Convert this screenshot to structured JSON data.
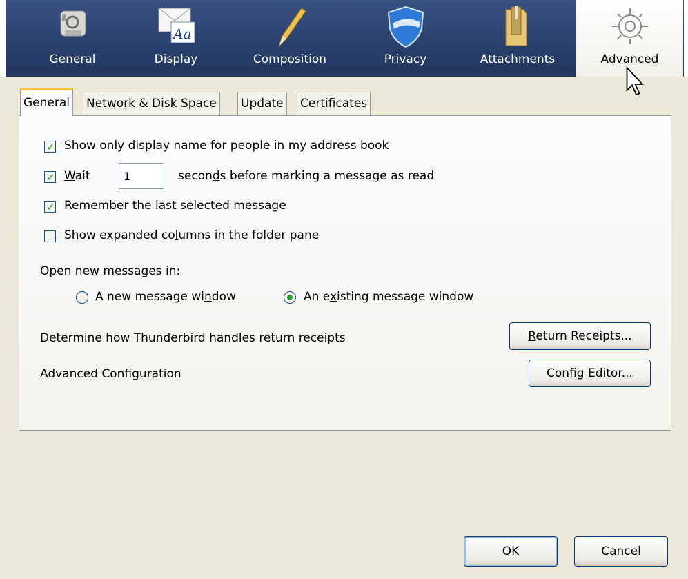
{
  "toolbar": {
    "panes": [
      {
        "label": "General",
        "icon": "general-pane-icon"
      },
      {
        "label": "Display",
        "icon": "display-pane-icon"
      },
      {
        "label": "Composition",
        "icon": "composition-pane-icon"
      },
      {
        "label": "Privacy",
        "icon": "privacy-pane-icon"
      },
      {
        "label": "Attachments",
        "icon": "attachments-pane-icon"
      },
      {
        "label": "Advanced",
        "icon": "advanced-pane-icon"
      }
    ],
    "selected": "Advanced"
  },
  "tabs": [
    {
      "label": "General",
      "active": true
    },
    {
      "label": "Network & Disk Space",
      "active": false
    },
    {
      "label": "Update",
      "active": false
    },
    {
      "label": "Certificates",
      "active": false
    }
  ],
  "general": {
    "options": {
      "show_display_name": {
        "pre": "Show only dis",
        "acc": "p",
        "post": "lay name for people in my address book",
        "checked": true
      },
      "wait": {
        "pre": "",
        "acc": "W",
        "post": "ait",
        "checked": true,
        "value": "1",
        "suffix_pre": "secon",
        "suffix_acc": "d",
        "suffix_post": "s before marking a message as read"
      },
      "remember_last": {
        "pre": "Remem",
        "acc": "b",
        "post": "er the last selected message",
        "checked": true
      },
      "expanded_columns": {
        "pre": "Show expanded co",
        "acc": "l",
        "post": "umns in the folder pane",
        "checked": false
      }
    },
    "open_new_label": "Open new messages in:",
    "radio_new": {
      "pre": "A new message wi",
      "acc": "n",
      "post": "dow",
      "selected": false
    },
    "radio_existing": {
      "pre": "An e",
      "acc": "x",
      "post": "isting message window",
      "selected": true
    },
    "receipts_label": "Determine how Thunderbird handles return receipts",
    "receipts_button": {
      "pre": "",
      "acc": "R",
      "post": "eturn Receipts..."
    },
    "advanced_config_label": "Advanced Configuration",
    "config_button": {
      "pre": "Confi",
      "acc": "g",
      "post": " Editor..."
    }
  },
  "dialog": {
    "ok": "OK",
    "cancel": "Cancel"
  },
  "colors": {
    "toolbar": "#2c4370",
    "check": "#21a121",
    "tab_highlight": "#ffc83c",
    "window": "#ece9d8"
  }
}
